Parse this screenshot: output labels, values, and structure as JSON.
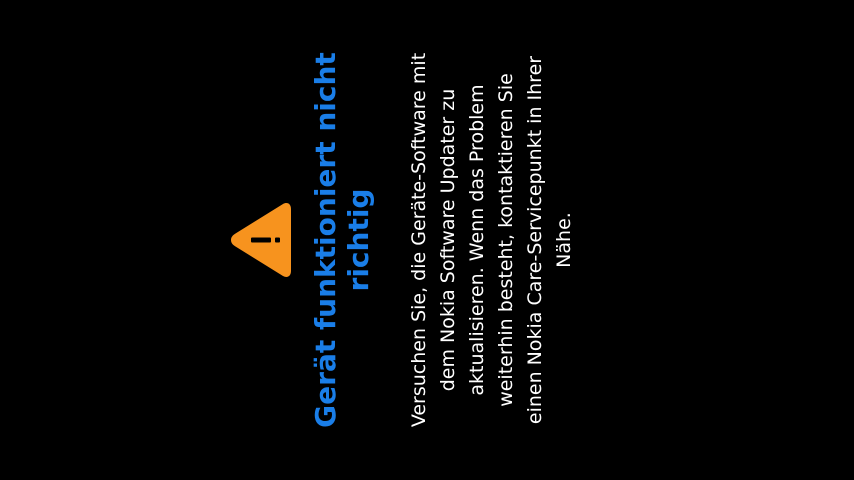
{
  "dialog": {
    "icon": "warning-icon",
    "accent_color": "#1a7ee8",
    "icon_color": "#f7931e",
    "title_lines": [
      "Gerät funktioniert nicht",
      "richtig"
    ],
    "message_lines": [
      "Versuchen Sie, die Geräte-Software mit",
      "dem Nokia Software Updater zu",
      "aktualisieren. Wenn das Problem",
      "weiterhin besteht, kontaktieren Sie",
      "einen Nokia Care-Servicepunkt in Ihrer",
      "Nähe."
    ]
  }
}
